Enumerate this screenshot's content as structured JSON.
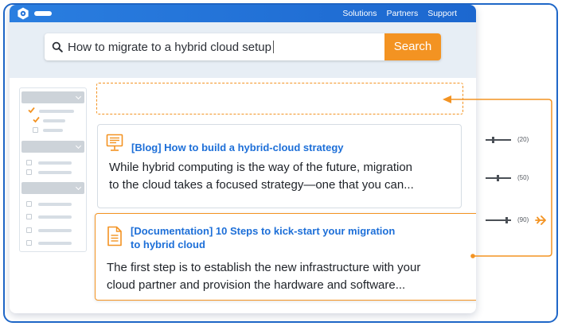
{
  "navbar": {
    "links": [
      "Solutions",
      "Partners",
      "Support"
    ]
  },
  "search": {
    "query": "How to migrate to a hybrid cloud setup",
    "button_label": "Search"
  },
  "results": [
    {
      "type_icon": "monitor-icon",
      "title": "[Blog] How to build a hybrid-cloud strategy",
      "snippet_lines": [
        "While hybrid computing is the way of the future, migration",
        "to the cloud takes a focused strategy—one that you can..."
      ]
    },
    {
      "type_icon": "document-icon",
      "title_lines": [
        "[Documentation] 10 Steps to kick-start your migration",
        "to hybrid cloud"
      ],
      "snippet_lines": [
        "The first step is to establish the new infrastructure with your",
        "cloud partner and provision the hardware and software..."
      ]
    }
  ],
  "scores": [
    {
      "label": "(20)",
      "level": 0.3
    },
    {
      "label": "(50)",
      "level": 0.5
    },
    {
      "label": "(90)",
      "level": 0.9
    }
  ],
  "colors": {
    "brand_blue": "#1d6fd8",
    "accent_orange": "#f39322",
    "search_band": "#e7eef5"
  }
}
